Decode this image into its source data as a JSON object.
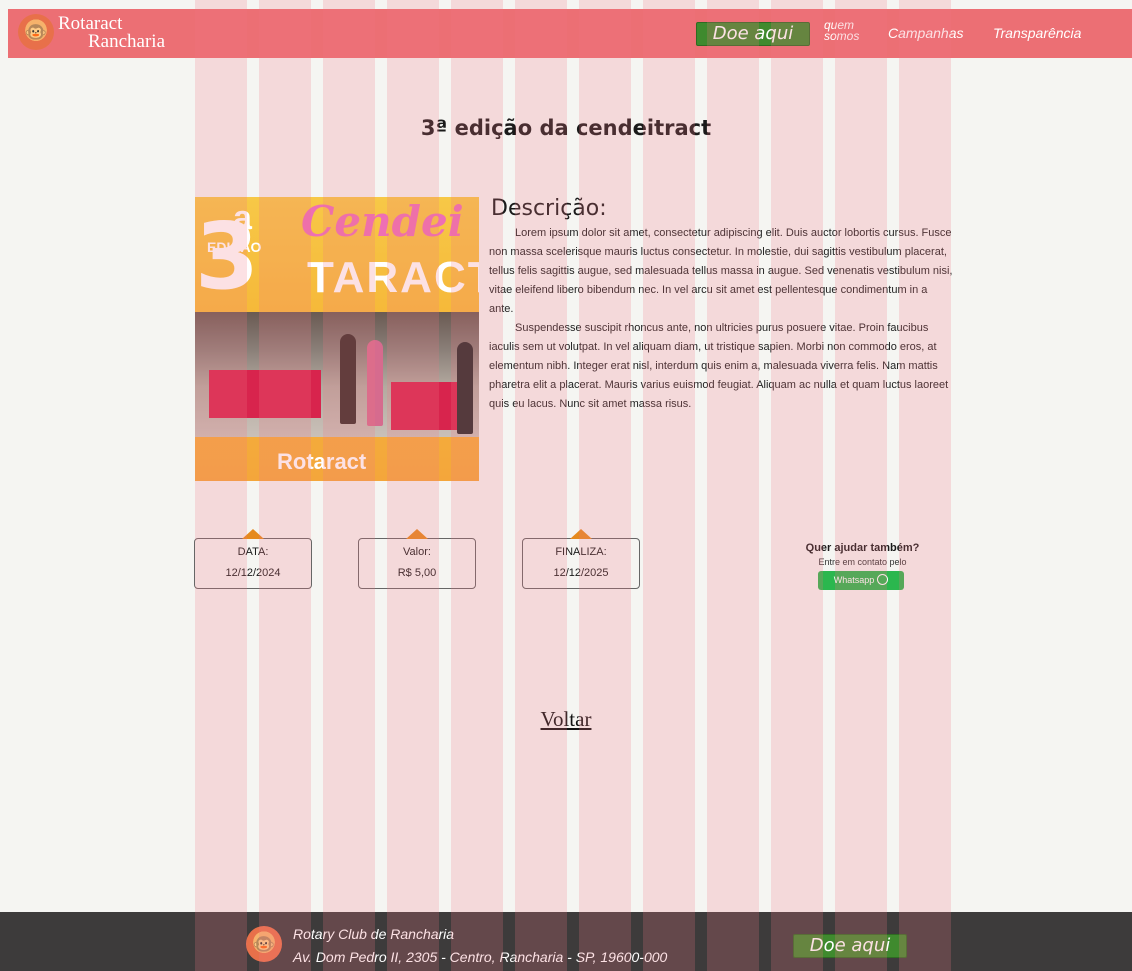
{
  "header": {
    "logo_icon": "monkey-mascot-icon",
    "logo_line1": "Rotaract",
    "logo_line2": "Rancharia",
    "donate_label": "Doe aqui",
    "nav": {
      "quem": "quem",
      "somos": "somos",
      "campanhas": "Campanhas",
      "transparencia": "Transparência"
    }
  },
  "main": {
    "title": "3ª edição da cendeitract",
    "image_text": {
      "big3": "3",
      "a": "a",
      "edicao": "EDIÇÃO",
      "cendei": "Cendei",
      "taract": "TARACT",
      "brand": "Rotaract"
    },
    "description_title": "Descrição:",
    "description_p1": "Lorem ipsum dolor sit amet, consectetur adipiscing elit. Duis auctor lobortis cursus. Fusce non massa scelerisque mauris luctus consectetur. In molestie, dui sagittis vestibulum placerat, tellus felis sagittis augue, sed malesuada tellus massa in augue. Sed venenatis vestibulum nisi, vitae eleifend libero bibendum nec. In vel arcu sit amet est pellentesque condimentum in a ante.",
    "description_p2": "Suspendesse suscipit rhoncus ante, non ultricies purus posuere vitae. Proin faucibus iaculis sem ut volutpat. In vel aliquam diam, ut tristique sapien. Morbi non commodo eros, at elementum nibh. Integer erat nisl, interdum quis enim a, malesuada viverra felis. Nam mattis pharetra elit a placerat. Mauris varius euismod feugiat. Aliquam ac nulla et quam luctus laoreet quis eu lacus. Nunc sit amet massa risus.",
    "info": [
      {
        "label": "DATA:",
        "value": "12/12/2024"
      },
      {
        "label": "Valor:",
        "value": "R$ 5,00"
      },
      {
        "label": "FINALIZA:",
        "value": "12/12/2025"
      }
    ],
    "help_title": "Quer ajudar também?",
    "help_sub": "Entre em contato pelo",
    "whatsapp_label": "Whatsapp",
    "whatsapp_icon": "whatsapp-icon",
    "back_label": "Voltar"
  },
  "footer": {
    "org": "Rotary Club de Rancharia",
    "address": "Av. Dom Pedro II, 2305 - Centro, Rancharia - SP, 19600-000",
    "donate_label": "Doe aqui"
  },
  "colors": {
    "header_bg": "#ec6f74",
    "donate_bg": "#3f8a2e",
    "accent_triangle": "#e58a1e",
    "whatsapp_bg": "#2bb74e",
    "footer_bg": "#3d3b3b",
    "grid_overlay": "#f07882"
  }
}
